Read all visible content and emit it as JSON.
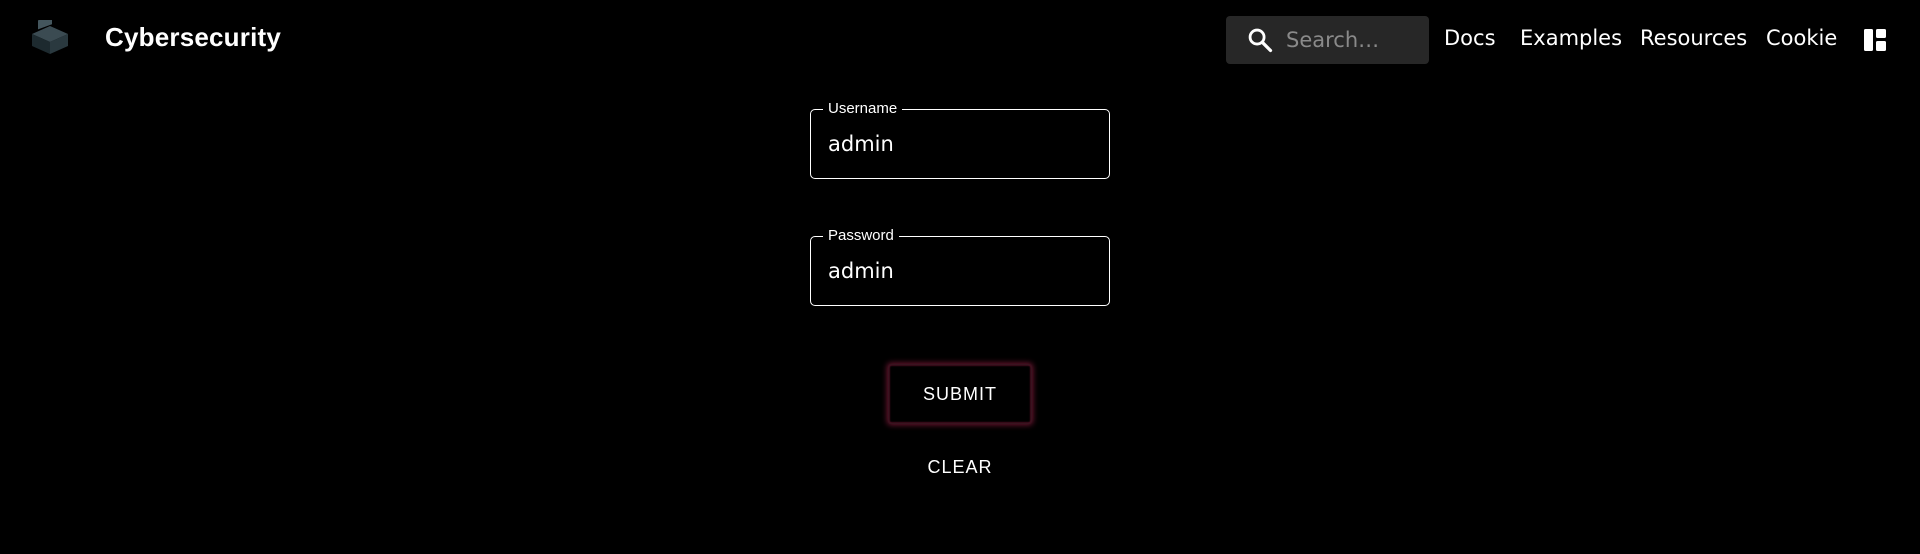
{
  "header": {
    "brand": "Cybersecurity",
    "search_placeholder": "Search…",
    "nav": [
      "Docs",
      "Examples",
      "Resources",
      "Cookie"
    ],
    "icons": {
      "logo": "laptop-logo-icon",
      "search": "search-icon",
      "layout": "layout-dashboard-icon"
    }
  },
  "form": {
    "username": {
      "label": "Username",
      "value": "admin"
    },
    "password": {
      "label": "Password",
      "value": "admin"
    },
    "submit_label": "SUBMIT",
    "clear_label": "CLEAR"
  },
  "colors": {
    "background": "#000000",
    "text": "#ffffff",
    "search_bg": "#272727",
    "submit_glow": "#c8285a"
  }
}
